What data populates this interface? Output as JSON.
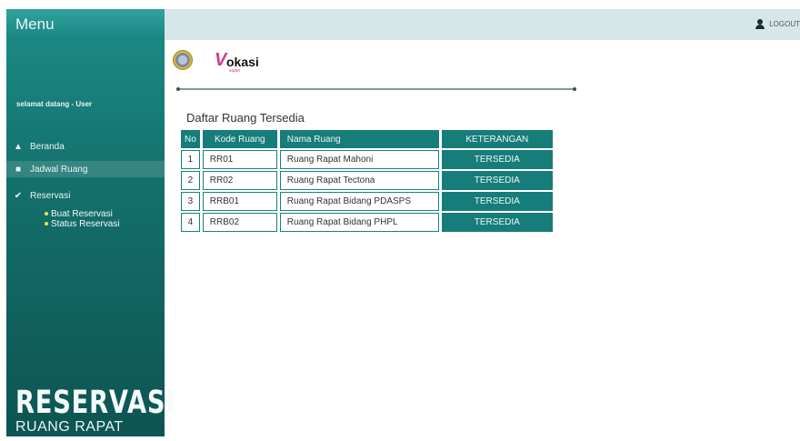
{
  "sidebar": {
    "menu_title": "Menu",
    "welcome": "selamat datang - User",
    "items": [
      {
        "label": "Beranda",
        "icon": "home-icon"
      },
      {
        "label": "Jadwal Ruang",
        "icon": "users-icon"
      },
      {
        "label": "Reservasi",
        "icon": "check-icon"
      }
    ],
    "sub_items": [
      "Buat Reservasi",
      "Status Reservasi"
    ],
    "brand_line1": "RESERVASI",
    "brand_line2": "RUANG RAPAT"
  },
  "topbar": {
    "logout_label": "LOGOUT",
    "logout_icon": "user-icon"
  },
  "logo": {
    "seal_icon": "government-seal-logo",
    "vokasi_v": "V",
    "vokasi_text": "okasi",
    "vokasi_sub": "super"
  },
  "main": {
    "section_title": "Daftar Ruang Tersedia",
    "table": {
      "headers": [
        "No",
        "Kode Ruang",
        "Nama Ruang",
        "KETERANGAN"
      ],
      "rows": [
        {
          "no": "1",
          "kode": "RR01",
          "nama": "Ruang Rapat Mahoni",
          "status": "TERSEDIA"
        },
        {
          "no": "2",
          "kode": "RR02",
          "nama": "Ruang Rapat Tectona",
          "status": "TERSEDIA"
        },
        {
          "no": "3",
          "kode": "RRB01",
          "nama": "Ruang Rapat Bidang PDASPS",
          "status": "TERSEDIA"
        },
        {
          "no": "4",
          "kode": "RRB02",
          "nama": "Ruang Rapat Bidang PHPL",
          "status": "TERSEDIA"
        }
      ]
    }
  },
  "colors": {
    "accent": "#167d7a",
    "topbar": "#d6e7e9",
    "sidebar_dark": "#0d5452"
  }
}
